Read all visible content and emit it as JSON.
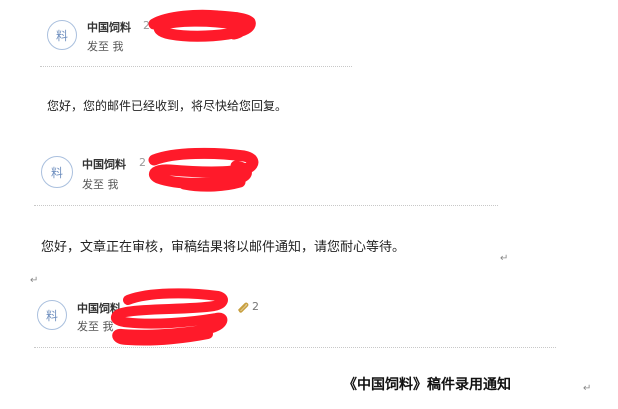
{
  "emails": [
    {
      "avatar_char": "料",
      "sender": "中国饲料",
      "date_visible": "2",
      "recipient": "发至 我",
      "body": "您好，您的邮件已经收到，将尽快给您回复。"
    },
    {
      "avatar_char": "料",
      "sender": "中国饲料",
      "date_visible": "2",
      "recipient": "发至 我",
      "body": "您好，文章正在审核，审稿结果将以邮件通知，请您耐心等待。"
    },
    {
      "avatar_char": "料",
      "sender": "中国饲料",
      "recipient": "发至 我",
      "attachment_count": "2"
    }
  ],
  "notice_title": "《中国饲料》稿件录用通知",
  "paragraph_mark": "↵",
  "colors": {
    "redaction": "#ff1a2a",
    "avatar_border": "#aac0de",
    "avatar_text": "#6f8fbf",
    "divider": "#c8c8c8"
  }
}
